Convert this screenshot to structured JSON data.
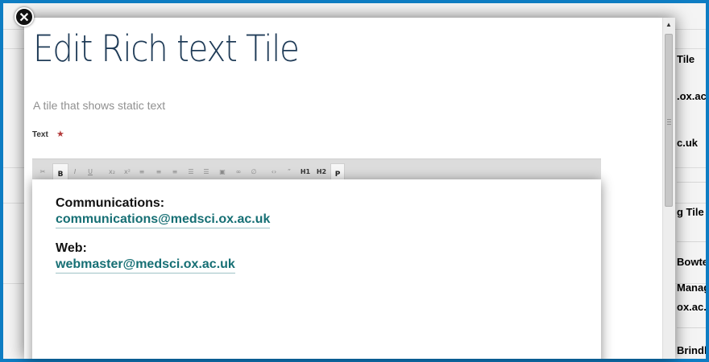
{
  "background": {
    "right_items": [
      {
        "text": "Tile",
        "style": "muted"
      },
      {
        "text": ".ox.ac",
        "style": "link"
      },
      {
        "text": "c.uk",
        "style": "link"
      },
      {
        "text": "g Tile",
        "style": "muted"
      },
      {
        "text": "Bowtel",
        "style": "name"
      },
      {
        "text": "Manage",
        "style": "small"
      },
      {
        "text": "ox.ac.uk",
        "style": "link"
      },
      {
        "text": "Brindle",
        "style": "name"
      }
    ]
  },
  "modal": {
    "close_label": "✕",
    "title": "Edit Rich text Tile",
    "description": "A tile that shows static text",
    "field_label": "Text",
    "required_marker": "★",
    "toolbar": [
      {
        "name": "cut-button",
        "label": "✂"
      },
      {
        "name": "bold-button",
        "label": "B",
        "active": true
      },
      {
        "name": "italic-button",
        "label": "I"
      },
      {
        "name": "underline-button",
        "label": "U"
      },
      {
        "name": "subscript-button",
        "label": "x₂"
      },
      {
        "name": "superscript-button",
        "label": "x²"
      },
      {
        "name": "align-left-button",
        "label": "≡"
      },
      {
        "name": "align-center-button",
        "label": "≡"
      },
      {
        "name": "align-right-button",
        "label": "≡"
      },
      {
        "name": "bullet-list-button",
        "label": "☰"
      },
      {
        "name": "numbered-list-button",
        "label": "☰"
      },
      {
        "name": "image-button",
        "label": "▣"
      },
      {
        "name": "link-button",
        "label": "∞"
      },
      {
        "name": "unlink-button",
        "label": "∅"
      },
      {
        "name": "code-button",
        "label": "‹›"
      },
      {
        "name": "blockquote-button",
        "label": "”"
      },
      {
        "name": "heading1-button",
        "label": "H1",
        "dark": true
      },
      {
        "name": "heading2-button",
        "label": "H2",
        "dark": true
      },
      {
        "name": "paragraph-button",
        "label": "P",
        "active": true
      }
    ],
    "editor": {
      "blocks": [
        {
          "heading": "Communications:",
          "link": "communications@medsci.ox.ac.uk"
        },
        {
          "heading": "Web:",
          "link": "webmaster@medsci.ox.ac.uk"
        }
      ]
    }
  }
}
